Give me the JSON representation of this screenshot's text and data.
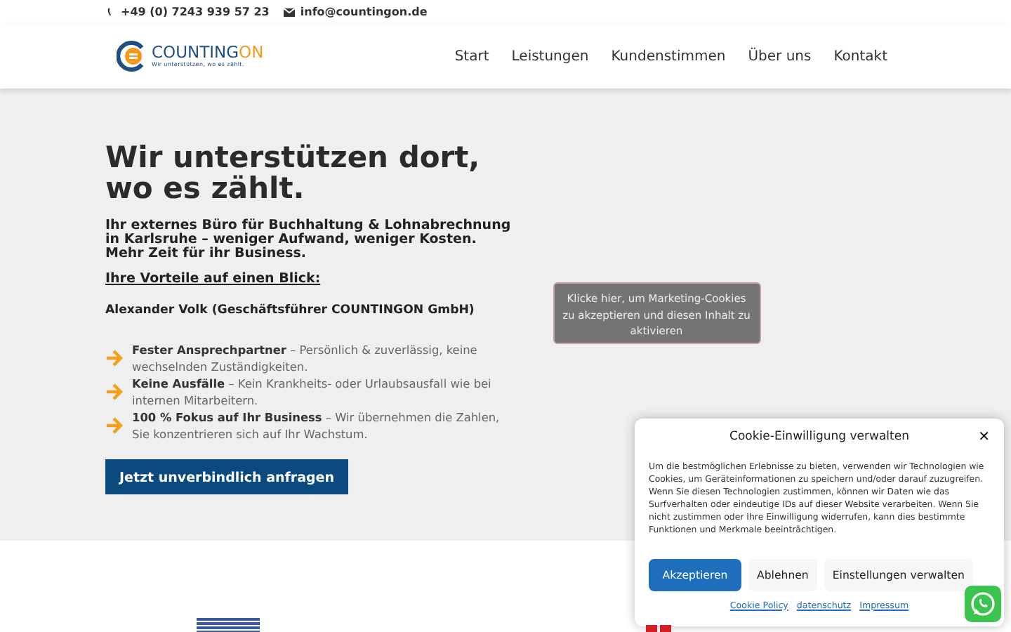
{
  "topbar": {
    "phone": "+49 (0) 7243 939 57 23",
    "email": "info@countingon.de"
  },
  "logo": {
    "name_main": "COUNTING",
    "name_accent": "ON",
    "tagline": "Wir unterstützen, wo es zählt."
  },
  "nav": [
    {
      "label": "Start"
    },
    {
      "label": "Leistungen"
    },
    {
      "label": "Kundenstimmen"
    },
    {
      "label": "Über uns"
    },
    {
      "label": "Kontakt"
    }
  ],
  "hero": {
    "title": "Wir unterstützen dort, wo es zählt.",
    "subtitle": "Ihr externes Büro für Buchhaltung & Lohnabrechnung in Karlsruhe – weniger Aufwand, weniger Kosten. Mehr Zeit für ihr Business.",
    "advantages_heading": "Ihre Vorteile auf einen Blick:",
    "person": "Alexander Volk (Geschäftsführer COUNTINGON GmbH)",
    "benefits": [
      {
        "text": "**Fester Ansprechpartner** – Persönlich & zuverlässig, keine wechselnden Zuständigkeiten."
      },
      {
        "text": "**Keine Ausfälle** – Kein Krankheits- oder Urlaubsausfall wie bei internen Mitarbeitern."
      },
      {
        "text": "**100 % Fokus auf Ihr Business** – Wir übernehmen die Zahlen, Sie konzentrieren sich auf Ihr Wachstum."
      }
    ],
    "cta": "Jetzt unverbindlich anfragen",
    "cookie_placeholder": "Klicke hier, um Marketing-Cookies zu akzeptieren und diesen Inhalt zu aktivieren"
  },
  "cookie_dialog": {
    "title": "Cookie-Einwilligung verwalten",
    "close": "✕",
    "text": "Um die bestmöglichen Erlebnisse zu bieten, verwenden wir Technologien wie Cookies, um Geräteinformationen zu speichern und/oder darauf zuzugreifen. Wenn Sie diesen Technologien zustimmen, können wir Daten wie das Surfverhalten oder eindeutige IDs auf dieser Website verarbeiten. Wenn Sie nicht zustimmen oder Ihre Einwilligung widerrufen, kann dies bestimmte Funktionen und Merkmale beeinträchtigen.",
    "buttons": [
      {
        "label": "Akzeptieren",
        "kind": "primary"
      },
      {
        "label": "Ablehnen",
        "kind": "secondary"
      },
      {
        "label": "Einstellungen verwalten",
        "kind": "secondary"
      }
    ],
    "links": [
      "Cookie Policy",
      "datenschutz",
      "Impressum"
    ]
  }
}
